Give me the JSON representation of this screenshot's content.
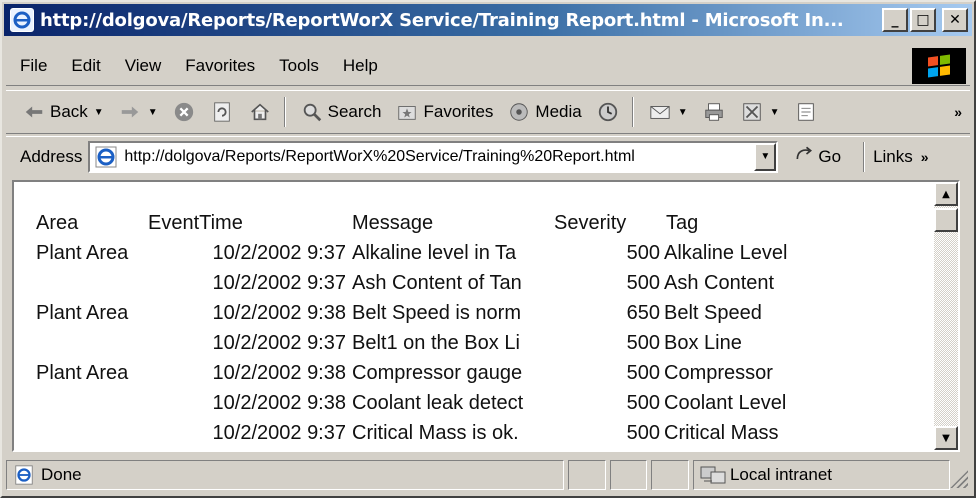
{
  "window": {
    "title": "http://dolgova/Reports/ReportWorX Service/Training Report.html - Microsoft In...",
    "controls": [
      "_",
      "□",
      "✕"
    ]
  },
  "menubar": {
    "items": [
      "File",
      "Edit",
      "View",
      "Favorites",
      "Tools",
      "Help"
    ]
  },
  "toolbar": {
    "back_label": "Back",
    "search_label": "Search",
    "favorites_label": "Favorites",
    "media_label": "Media",
    "more": "»"
  },
  "address": {
    "label": "Address",
    "url": "http://dolgova/Reports/ReportWorX%20Service/Training%20Report.html",
    "go_label": "Go",
    "links_label": "Links",
    "links_more": "»"
  },
  "report": {
    "headers": {
      "area": "Area",
      "event_time": "EventTime",
      "message": "Message",
      "severity": "Severity",
      "tag": "Tag"
    },
    "rows": [
      {
        "area": "Plant Area",
        "event_time": "10/2/2002 9:37",
        "message": "Alkaline level in Ta",
        "severity": "500",
        "tag": "Alkaline Level"
      },
      {
        "area": "",
        "event_time": "10/2/2002 9:37",
        "message": "Ash Content of Tan",
        "severity": "500",
        "tag": "Ash Content"
      },
      {
        "area": "Plant Area",
        "event_time": "10/2/2002 9:38",
        "message": "Belt Speed is norm",
        "severity": "650",
        "tag": "Belt Speed"
      },
      {
        "area": "",
        "event_time": "10/2/2002 9:37",
        "message": "Belt1 on the Box Li",
        "severity": "500",
        "tag": "Box Line"
      },
      {
        "area": "Plant Area",
        "event_time": "10/2/2002 9:38",
        "message": "Compressor gauge",
        "severity": "500",
        "tag": "Compressor"
      },
      {
        "area": "",
        "event_time": "10/2/2002 9:38",
        "message": "Coolant leak detect",
        "severity": "500",
        "tag": "Coolant Level"
      },
      {
        "area": "",
        "event_time": "10/2/2002 9:37",
        "message": "Critical Mass is ok.",
        "severity": "500",
        "tag": "Critical Mass"
      }
    ]
  },
  "statusbar": {
    "status_text": "Done",
    "zone_text": "Local intranet"
  },
  "colors": {
    "title_start": "#0a246a",
    "title_end": "#a6caf0",
    "chrome": "#d4d0c8"
  }
}
